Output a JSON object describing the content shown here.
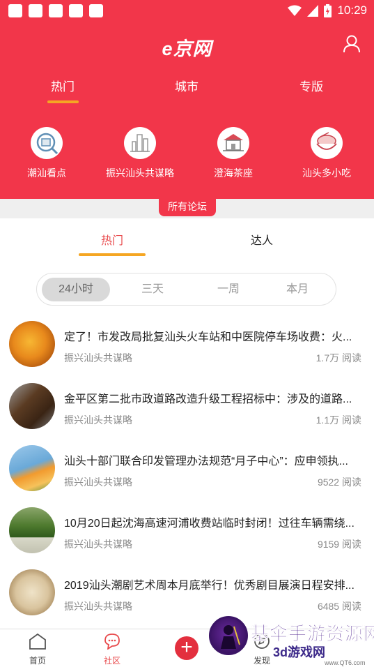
{
  "status_bar": {
    "time": "10:29"
  },
  "header": {
    "logo": "e京网",
    "top_tabs": [
      {
        "label": "热门"
      },
      {
        "label": "城市"
      },
      {
        "label": "专版"
      }
    ],
    "forums": [
      {
        "label": "潮汕看点",
        "icon": "news-magnifier-icon"
      },
      {
        "label": "振兴汕头共谋略",
        "icon": "city-skyline-icon"
      },
      {
        "label": "澄海茶座",
        "icon": "tea-house-icon"
      },
      {
        "label": "汕头多小吃",
        "icon": "snack-bowl-icon"
      }
    ]
  },
  "all_forums_label": "所有论坛",
  "sub_tabs": [
    {
      "label": "热门"
    },
    {
      "label": "达人"
    }
  ],
  "time_filter": [
    {
      "label": "24小时"
    },
    {
      "label": "三天"
    },
    {
      "label": "一周"
    },
    {
      "label": "本月"
    }
  ],
  "posts": [
    {
      "title": "定了！市发改局批复汕头火车站和中医院停车场收费：火...",
      "source": "振兴汕头共谋略",
      "reads": "1.7万 阅读",
      "avatar": "orange-fruit-avatar"
    },
    {
      "title": "金平区第二批市政道路改造升级工程招标中：涉及的道路...",
      "source": "振兴汕头共谋略",
      "reads": "1.1万 阅读",
      "avatar": "dog-avatar"
    },
    {
      "title": "汕头十部门联合印发管理办法规范“月子中心”：应申领执...",
      "source": "振兴汕头共谋略",
      "reads": "9522 阅读",
      "avatar": "flower-avatar"
    },
    {
      "title": "10月20日起沈海高速河浦收费站临时封闭！过往车辆需绕...",
      "source": "振兴汕头共谋略",
      "reads": "9159 阅读",
      "avatar": "frog-avatar"
    },
    {
      "title": "2019汕头潮剧艺术周本月底举行！优秀剧目展演日程安排...",
      "source": "振兴汕头共谋略",
      "reads": "6485 阅读",
      "avatar": "cat-avatar"
    }
  ],
  "bottom_nav": [
    {
      "label": "首页",
      "icon": "home-icon"
    },
    {
      "label": "社区",
      "icon": "chat-bubble-icon"
    },
    {
      "label": "+",
      "icon": "add-icon"
    },
    {
      "label": "发现",
      "icon": "discover-icon"
    }
  ],
  "watermark": {
    "line1": "基伞手游资源网",
    "line2": "3d游戏网",
    "line3": "www.QT6.com"
  },
  "colors": {
    "brand_red": "#f2364a",
    "accent_orange": "#f5a623",
    "active_text": "#e8494b"
  }
}
